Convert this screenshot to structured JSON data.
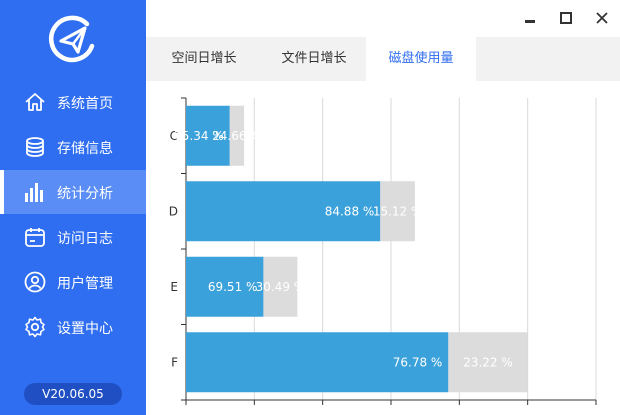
{
  "sidebar": {
    "items": [
      {
        "label": "系统首页",
        "icon": "home-icon",
        "active": false
      },
      {
        "label": "存储信息",
        "icon": "database-icon",
        "active": false
      },
      {
        "label": "统计分析",
        "icon": "bar-chart-icon",
        "active": true
      },
      {
        "label": "访问日志",
        "icon": "calendar-log-icon",
        "active": false
      },
      {
        "label": "用户管理",
        "icon": "user-icon",
        "active": false
      },
      {
        "label": "设置中心",
        "icon": "gear-icon",
        "active": false
      }
    ],
    "version": "V20.06.05"
  },
  "colors": {
    "primary": "#2f6ef0",
    "used": "#3aa1db",
    "free": "#dcdcdc"
  },
  "tabs": [
    {
      "label": "空间日增长",
      "active": false
    },
    {
      "label": "文件日增长",
      "active": false
    },
    {
      "label": "磁盘使用量",
      "active": true
    }
  ],
  "chart_data": {
    "type": "bar",
    "orientation": "horizontal",
    "stacked": true,
    "categories": [
      "C",
      "D",
      "E",
      "F"
    ],
    "series": [
      {
        "values": [
          75.34,
          84.88,
          69.51,
          76.78
        ],
        "labels": [
          "75.34 %",
          "84.88 %",
          "69.51 %",
          "76.78 %"
        ]
      },
      {
        "values": [
          24.66,
          15.12,
          30.49,
          23.22
        ],
        "labels": [
          "24.66 %",
          "15.12 %",
          "30.49 %",
          "23.22 %"
        ]
      }
    ],
    "totals": [
      85,
      335,
      163,
      500
    ],
    "xlim": [
      0,
      600
    ],
    "grid": true
  }
}
